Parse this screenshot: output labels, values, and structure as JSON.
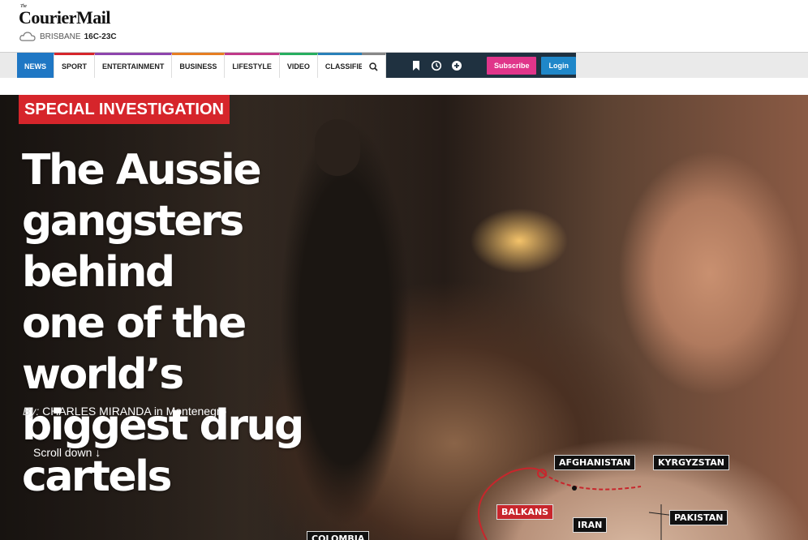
{
  "header": {
    "logo_small": "The",
    "logo": "CourierMail",
    "weather": {
      "icon": "cloud-sun-icon",
      "city": "BRISBANE",
      "temp": "16C-23C"
    }
  },
  "nav": {
    "items": [
      {
        "label": "NEWS",
        "accent": "#1f77c4"
      },
      {
        "label": "SPORT",
        "accent": "#d6252b"
      },
      {
        "label": "ENTERTAINMENT",
        "accent": "#8e44ad"
      },
      {
        "label": "BUSINESS",
        "accent": "#e67e22"
      },
      {
        "label": "LIFESTYLE",
        "accent": "#c0398a"
      },
      {
        "label": "VIDEO",
        "accent": "#27ae60"
      },
      {
        "label": "CLASSIFIEDS",
        "accent": "#2980b9"
      }
    ],
    "icons": [
      "search-icon",
      "bookmark-icon",
      "history-icon",
      "plus-circle-icon"
    ],
    "subscribe": "Subscribe",
    "login": "Login"
  },
  "hero": {
    "tag": "SPECIAL INVESTIGATION",
    "headline": [
      "The Aussie",
      "gangsters behind",
      "one of the world’s",
      "biggest drug",
      "cartels"
    ],
    "byline_prefix": "By:",
    "byline": "CHARLES MIRANDA in Montenegro",
    "scroll": "Scroll down ↓",
    "map_labels": [
      "AFGHANISTAN",
      "KYRGYZSTAN",
      "BALKANS",
      "IRAN",
      "PAKISTAN",
      "COLOMBIA"
    ]
  },
  "colors": {
    "tag": "#d6252b",
    "nav_active": "#1f77c4",
    "subscribe": "#e0358a",
    "login": "#1f87c9",
    "nav_dark": "#1f3140"
  }
}
